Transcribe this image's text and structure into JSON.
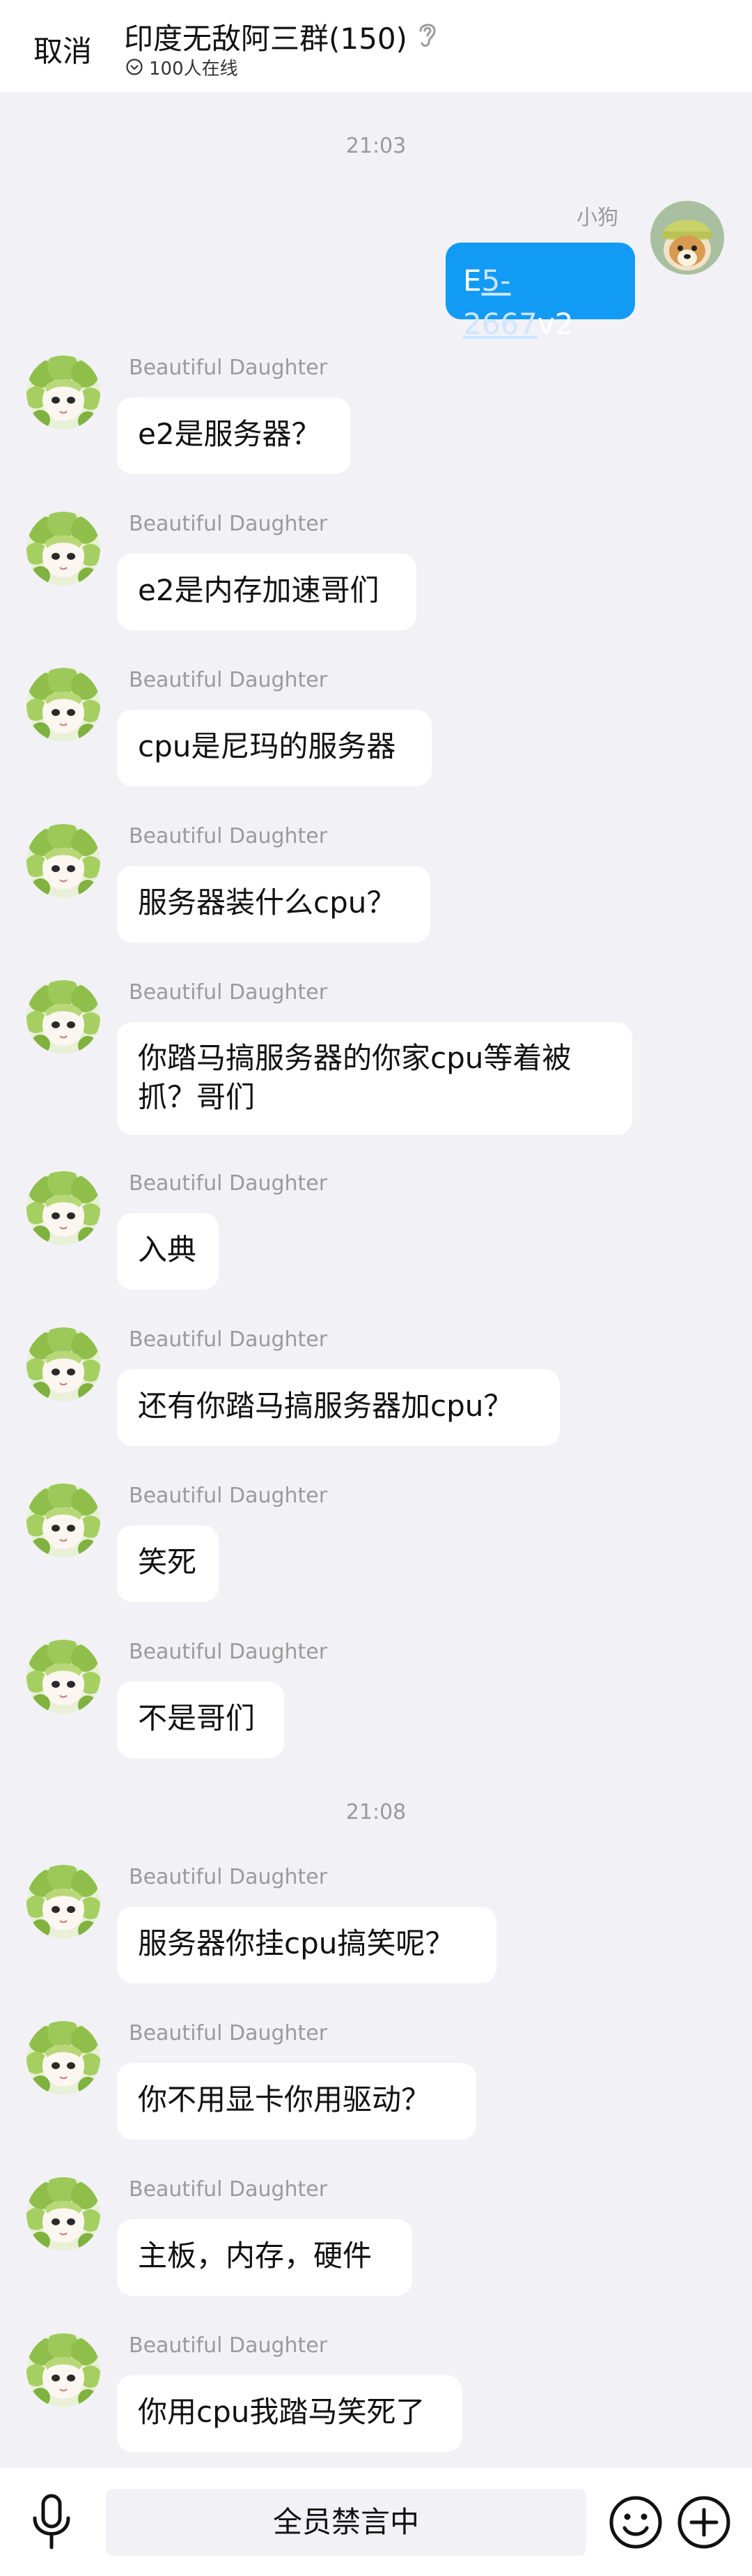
{
  "header": {
    "cancel_label": "取消",
    "group_name": "印度无敌阿三群(150)",
    "online_text": "100人在线"
  },
  "timestamps": [
    "21:03",
    "21:08"
  ],
  "self_message": {
    "sender": "小狗",
    "text_prefix": "E",
    "text_link": "5-2667",
    "text_suffix": "v2"
  },
  "other_sender": "Beautiful Daughter",
  "messages": [
    {
      "text": "e2是服务器？"
    },
    {
      "text": "e2是内存加速哥们"
    },
    {
      "text": "cpu是尼玛的服务器"
    },
    {
      "text": "服务器装什么cpu？"
    },
    {
      "text_line1": "你踏马搞服务器的你家cpu等着被",
      "text_line2": "抓？哥们"
    },
    {
      "text": "入典"
    },
    {
      "text": "还有你踏马搞服务器加cpu？"
    },
    {
      "text": "笑死"
    },
    {
      "text": "不是哥们"
    },
    {
      "text": "服务器你挂cpu搞笑呢？"
    },
    {
      "text": "你不用显卡你用驱动？"
    },
    {
      "text": "主板，内存，硬件"
    },
    {
      "text": "你用cpu我踏马笑死了"
    }
  ],
  "bottom_bar": {
    "mute_text": "全员禁言中"
  },
  "colors": {
    "self_bubble": "#129bf5",
    "page_bg": "#f2f1f6",
    "bubble_bg": "#ffffff"
  }
}
